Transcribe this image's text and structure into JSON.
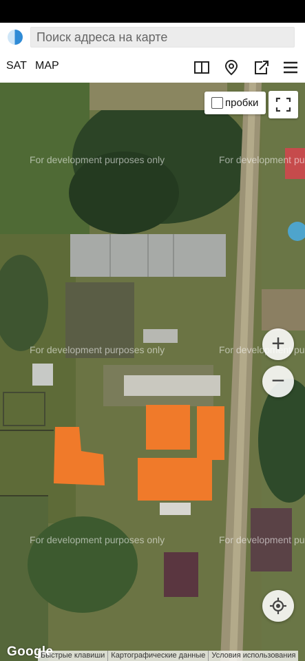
{
  "search": {
    "placeholder": "Поиск адреса на карте"
  },
  "toolbar": {
    "sat_label": "SAT",
    "map_label": "MAP"
  },
  "map": {
    "traffic_label": "пробки",
    "traffic_checked": false,
    "watermark": "For development purposes only",
    "zoom_in_label": "+",
    "zoom_out_label": "−",
    "google_logo": "Google",
    "attribution": {
      "shortcuts": "Быстрые клавиши",
      "map_data": "Картографические данные",
      "terms": "Условия использования"
    }
  },
  "colors": {
    "roof_orange": "#f07a2a",
    "globe_blue": "#2f8bd6"
  }
}
